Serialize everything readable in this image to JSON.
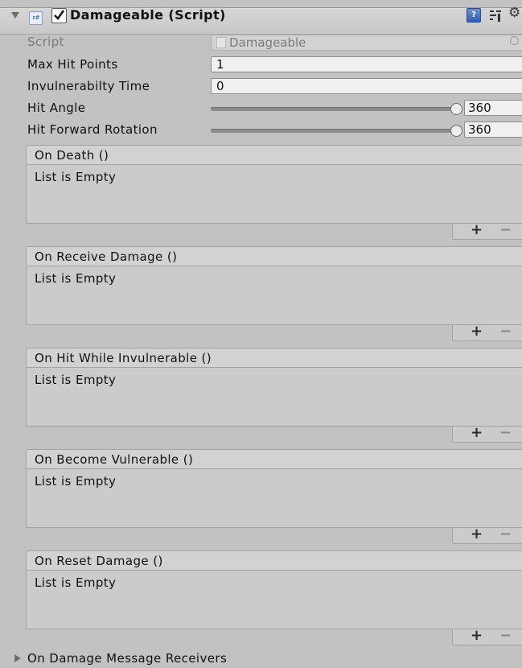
{
  "component": {
    "title": "Damageable (Script)",
    "enabled": true,
    "cs_badge": "c#"
  },
  "fields": {
    "script": {
      "label": "Script",
      "value": "Damageable"
    },
    "max_hit_points": {
      "label": "Max Hit Points",
      "value": "1"
    },
    "invulnerability_time": {
      "label": "Invulnerabilty Time",
      "value": "0"
    },
    "hit_angle": {
      "label": "Hit Angle",
      "value": "360",
      "fraction": 1.0
    },
    "hit_forward_rotation": {
      "label": "Hit Forward Rotation",
      "value": "360",
      "fraction": 1.0
    }
  },
  "events": [
    {
      "title": "On Death ()",
      "empty_text": "List is Empty"
    },
    {
      "title": "On Receive Damage ()",
      "empty_text": "List is Empty"
    },
    {
      "title": "On Hit While Invulnerable ()",
      "empty_text": "List is Empty"
    },
    {
      "title": "On Become Vulnerable ()",
      "empty_text": "List is Empty"
    },
    {
      "title": "On Reset Damage ()",
      "empty_text": "List is Empty"
    }
  ],
  "list_buttons": {
    "add": "+",
    "remove": "−"
  },
  "bottom_foldout": {
    "label": "On Damage Message Receivers"
  },
  "icons": {
    "foldout": "triangle-down-icon",
    "help": "help-icon",
    "preset": "preset-icon",
    "settings": "gear-icon"
  }
}
